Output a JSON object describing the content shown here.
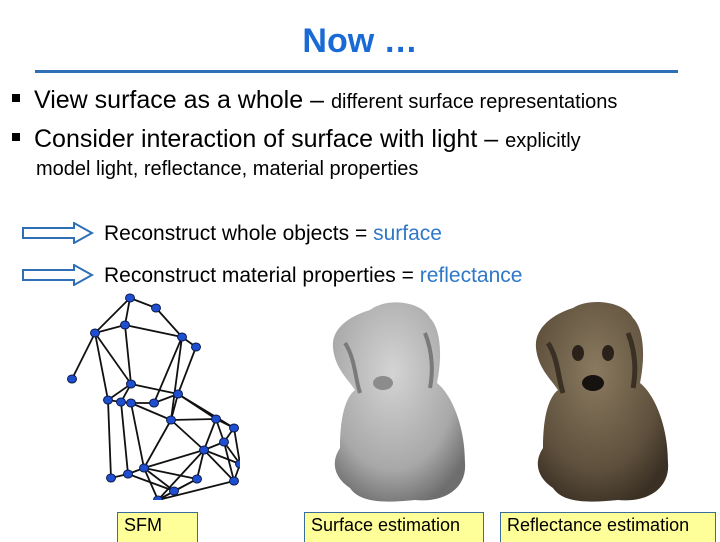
{
  "slide": {
    "title": "Now …",
    "bullets": [
      {
        "main": "View surface as a whole – ",
        "detail": "different surface representations"
      },
      {
        "main": "Consider interaction of surface with light – ",
        "detail": "explicitly",
        "continuation": "model light, reflectance, material properties"
      }
    ],
    "arrows": [
      {
        "icon": "right-arrow-icon",
        "text": "Reconstruct whole objects = ",
        "highlight": "surface"
      },
      {
        "icon": "right-arrow-icon",
        "text": "Reconstruct material properties = ",
        "highlight": "reflectance"
      }
    ],
    "figures": [
      {
        "name": "sfm-point-mesh",
        "label": "SFM"
      },
      {
        "name": "gray-dog-surface",
        "label": "Surface estimation"
      },
      {
        "name": "brown-dog-reflectance",
        "label": "Reflectance estimation"
      }
    ],
    "colors": {
      "title": "#1a6ad6",
      "title_rule": "#2f6fb5",
      "highlight": "#2f78c8",
      "mesh_node": "#1f4fd0",
      "label_bg": "#ffff99",
      "label_border": "#3b6d9a"
    }
  }
}
